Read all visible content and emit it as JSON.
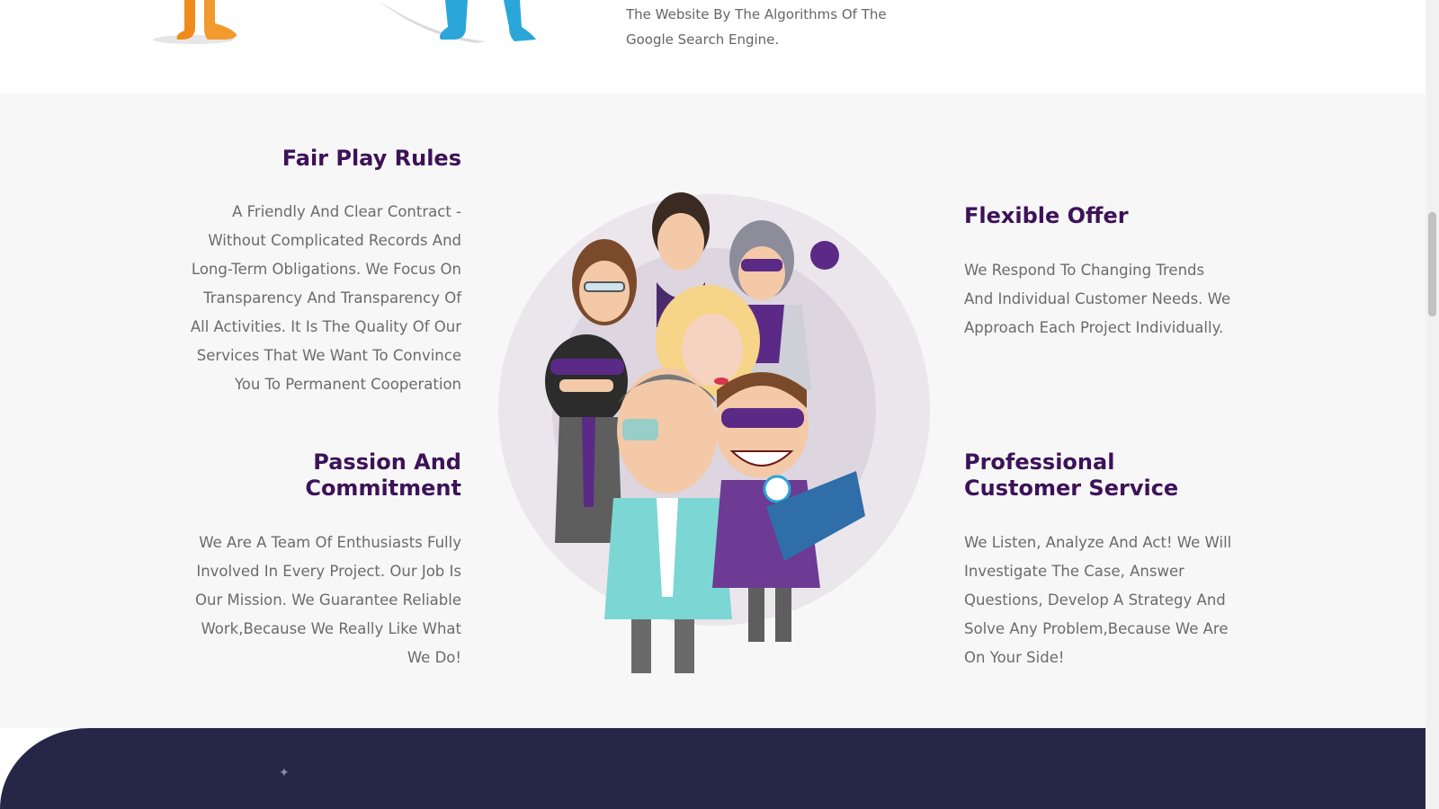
{
  "top_section": {
    "text": "The Website By The Algorithms Of The Google Search Engine."
  },
  "features": {
    "fair_play": {
      "title": "Fair Play Rules",
      "body": "A Friendly And Clear Contract - Without Complicated Records And Long-Term Obligations. We Focus On Transparency And Transparency Of All Activities. It Is The Quality Of Our Services That We Want To Convince You To Permanent Cooperation"
    },
    "passion": {
      "title": "Passion And Commitment",
      "body": "We Are A Team Of Enthusiasts Fully Involved In Every Project. Our Job Is Our Mission. We Guarantee Reliable Work,Because We Really Like What We Do!"
    },
    "flexible": {
      "title": "Flexible Offer",
      "body": "We Respond To Changing Trends And Individual Customer Needs. We Approach Each Project Individually."
    },
    "service": {
      "title": "Professional Customer Service",
      "body": "We Listen, Analyze And Act! We Will Investigate The Case, Answer Questions, Develop A Strategy And Solve Any Problem,Because We Are On Your Side!"
    }
  },
  "colors": {
    "heading": "#3d1258",
    "body_text": "#6b6b6b",
    "section_bg": "#f7f7f7",
    "footer_bg": "#262747",
    "accent_purple": "#5b2a86"
  }
}
